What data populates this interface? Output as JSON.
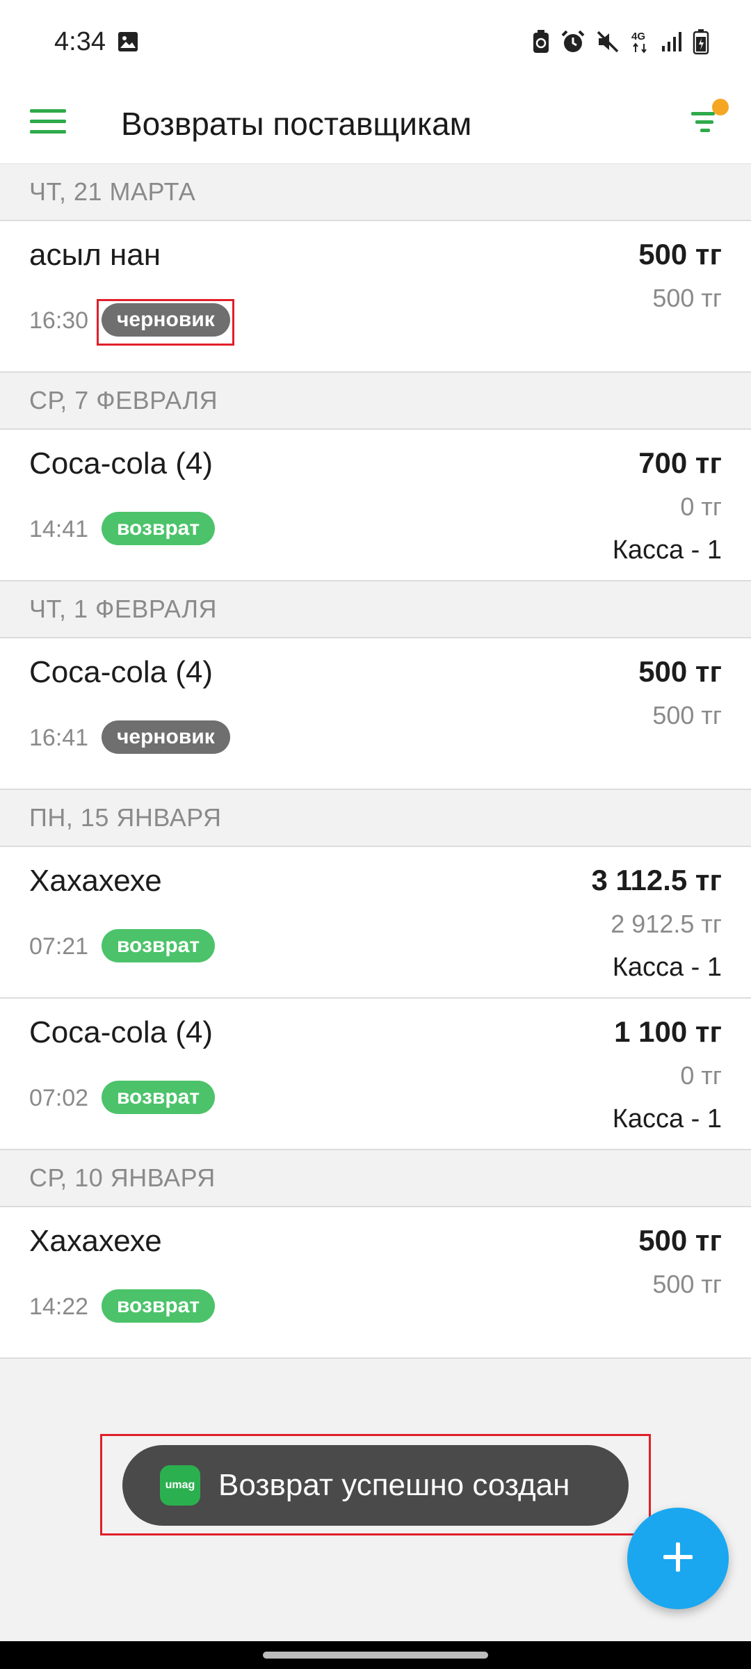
{
  "status_bar": {
    "time": "4:34",
    "icons": [
      "image-icon",
      "battery-saver-icon",
      "alarm-icon",
      "mute-icon",
      "4g-icon",
      "signal-icon",
      "battery-icon"
    ],
    "network": "4G"
  },
  "app_bar": {
    "title": "Возвраты поставщикам",
    "accent_color": "#2eaa4a",
    "filter_dot_color": "#f5a623"
  },
  "groups": [
    {
      "date": "ЧТ, 21 МАРТА",
      "items": [
        {
          "name": "асыл нан",
          "time": "16:30",
          "status": "черновик",
          "status_type": "draft",
          "amount": "500 тг",
          "paid": "500 тг",
          "kassa": ""
        }
      ]
    },
    {
      "date": "СР, 7 ФЕВРАЛЯ",
      "items": [
        {
          "name": "Coca-cola (4)",
          "time": "14:41",
          "status": "возврат",
          "status_type": "returned",
          "amount": "700 тг",
          "paid": "0 тг",
          "kassa": "Касса - 1"
        }
      ]
    },
    {
      "date": "ЧТ, 1 ФЕВРАЛЯ",
      "items": [
        {
          "name": "Coca-cola (4)",
          "time": "16:41",
          "status": "черновик",
          "status_type": "draft",
          "amount": "500 тг",
          "paid": "500 тг",
          "kassa": ""
        }
      ]
    },
    {
      "date": "ПН, 15 ЯНВАРЯ",
      "items": [
        {
          "name": "Хахахехе",
          "time": "07:21",
          "status": "возврат",
          "status_type": "returned",
          "amount": "3 112.5 тг",
          "paid": "2 912.5 тг",
          "kassa": "Касса - 1"
        },
        {
          "name": "Coca-cola (4)",
          "time": "07:02",
          "status": "возврат",
          "status_type": "returned",
          "amount": "1 100 тг",
          "paid": "0 тг",
          "kassa": "Касса - 1"
        }
      ]
    },
    {
      "date": "СР, 10 ЯНВАРЯ",
      "items": [
        {
          "name": "Хахахехе",
          "time": "14:22",
          "status": "возврат",
          "status_type": "returned",
          "amount": "500 тг",
          "paid": "500 тг",
          "kassa": ""
        }
      ]
    }
  ],
  "toast": {
    "logo_text": "umag",
    "message": "Возврат успешно создан"
  },
  "fab": {
    "icon": "plus-icon",
    "color": "#1aa7f0"
  },
  "colors": {
    "draft_badge": "#6f6f6f",
    "returned_badge": "#4cc36a",
    "highlight": "#e0202a"
  }
}
